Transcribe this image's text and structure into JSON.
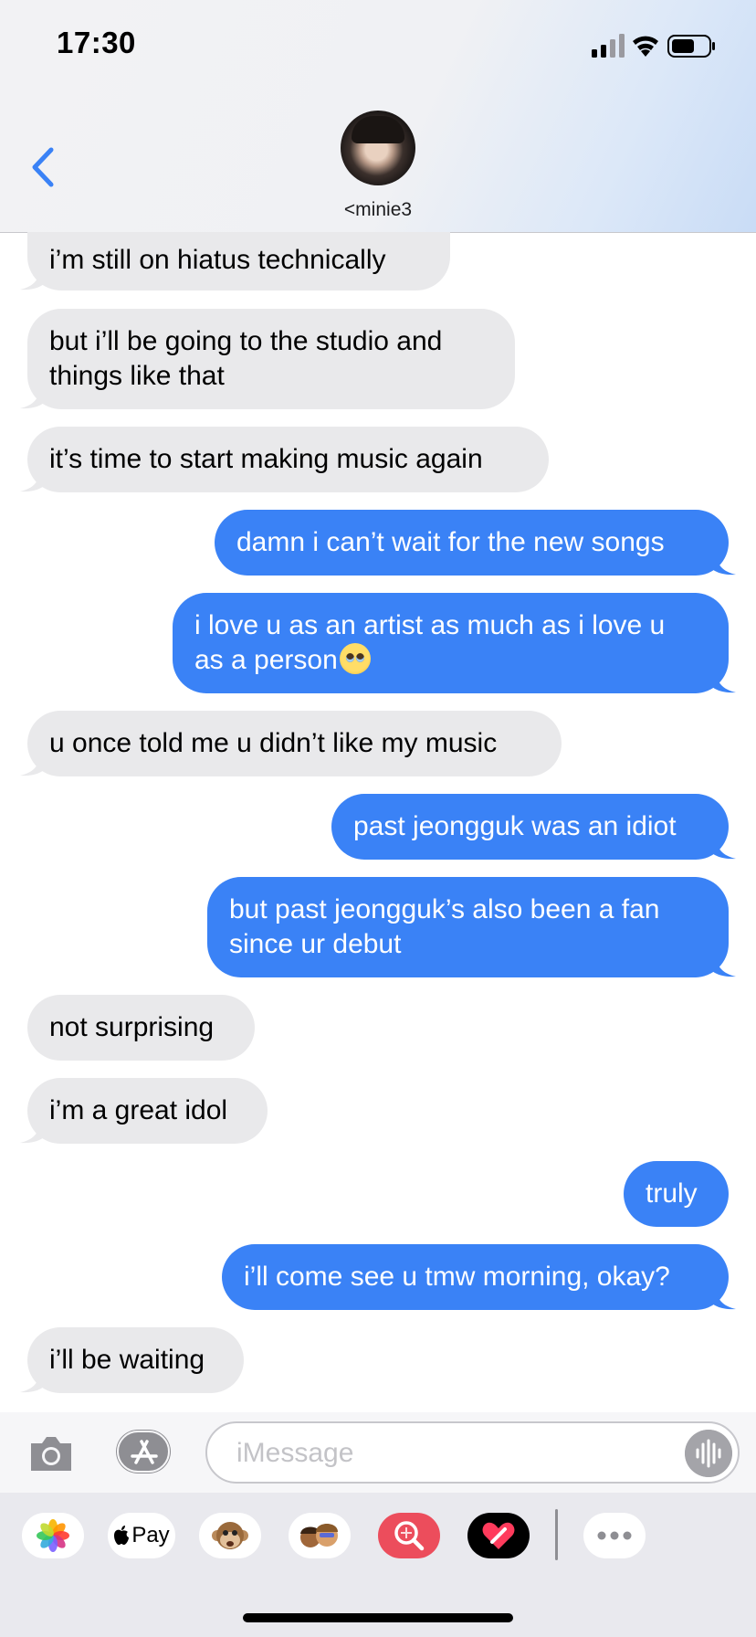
{
  "status_bar": {
    "time": "17:30"
  },
  "contact": {
    "name": "<minie3"
  },
  "messages": [
    {
      "side": "in",
      "text": "i’m still on hiatus technically"
    },
    {
      "side": "in",
      "lines": [
        "but i’ll be going to the studio and",
        "things like that"
      ]
    },
    {
      "side": "in",
      "text": "it’s time to start making music again"
    },
    {
      "side": "out",
      "text": "damn i can’t wait for the new songs"
    },
    {
      "side": "out",
      "lines": [
        "i love u as an artist as much as i love u",
        "as a person"
      ],
      "emoji": "pleading-face"
    },
    {
      "side": "in",
      "text": "u once told me u didn’t like my music"
    },
    {
      "side": "out",
      "text": "past jeongguk was an idiot"
    },
    {
      "side": "out",
      "lines": [
        "but past jeongguk’s also been a fan",
        "since ur debut"
      ]
    },
    {
      "side": "in",
      "text": "not surprising"
    },
    {
      "side": "in",
      "text": "i’m a great idol"
    },
    {
      "side": "out",
      "text": "truly"
    },
    {
      "side": "out",
      "text": "i’ll come see u tmw morning, okay?"
    },
    {
      "side": "in",
      "text": "i’ll be waiting"
    }
  ],
  "input": {
    "placeholder": "iMessage",
    "value": ""
  },
  "drawer": {
    "apps": [
      "photos-icon",
      "apple-pay-icon",
      "memoji-monkey-icon",
      "memoji-icon",
      "images-search-icon",
      "digital-touch-icon",
      "more-icon"
    ],
    "apple_pay_label": "Pay"
  },
  "colors": {
    "incoming": "#e9e9eb",
    "outgoing": "#3a82f6",
    "accent": "#3a82f6"
  }
}
